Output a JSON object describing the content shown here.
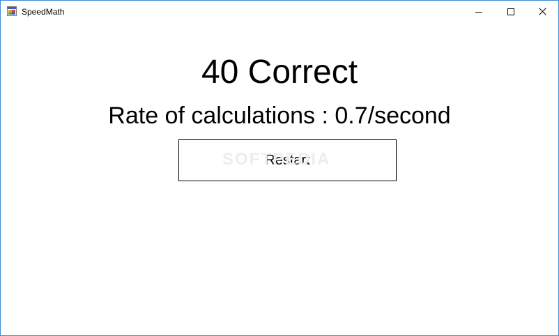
{
  "window": {
    "title": "SpeedMath",
    "border_color": "#3c8bd6",
    "icons": [
      "app-icon",
      "minimize-icon",
      "maximize-icon",
      "close-icon"
    ]
  },
  "main": {
    "score_text": "40 Correct",
    "rate_text": "Rate of calculations : 0.7/second",
    "restart_label": "Restart",
    "watermark": "SOFTPEDIA"
  }
}
